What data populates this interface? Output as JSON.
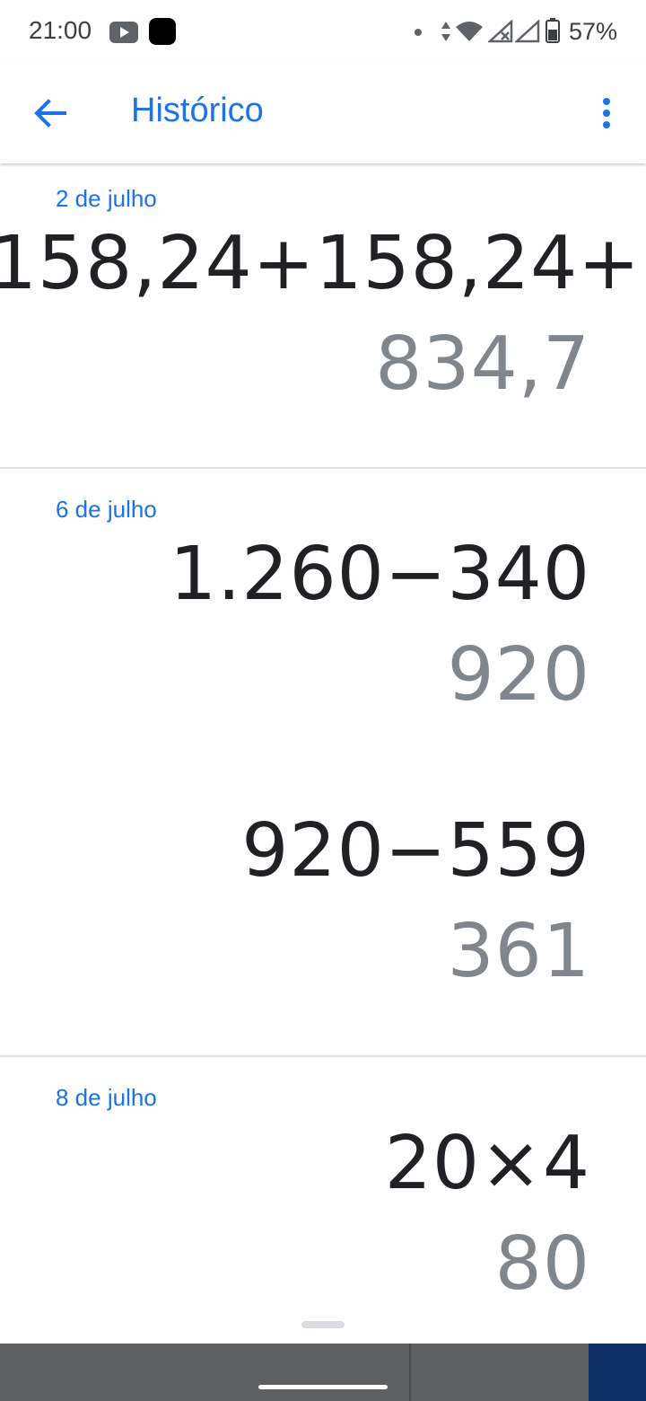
{
  "status_bar": {
    "time": "21:00",
    "battery": "57%",
    "icons": [
      "youtube-icon",
      "app-icon",
      "notification-dot-icon",
      "data-arrows-icon",
      "wifi-icon",
      "signal-icon",
      "signal-no-data-icon",
      "battery-icon"
    ]
  },
  "app_bar": {
    "title": "Histórico",
    "back_icon": "arrow-back-icon",
    "menu_icon": "more-vert-icon"
  },
  "history": [
    {
      "date": "2 de julho",
      "entries": [
        {
          "expression": "158,24+158,24+",
          "result": "834,7"
        }
      ]
    },
    {
      "date": "6 de julho",
      "entries": [
        {
          "expression": "1.260−340",
          "result": "920"
        },
        {
          "expression": "920−559",
          "result": "361"
        }
      ]
    },
    {
      "date": "8 de julho",
      "entries": [
        {
          "expression": "20×4",
          "result": "80"
        }
      ]
    }
  ],
  "colors": {
    "accent": "#1a73e8",
    "expression_text": "#202124",
    "result_text": "#80868b"
  }
}
